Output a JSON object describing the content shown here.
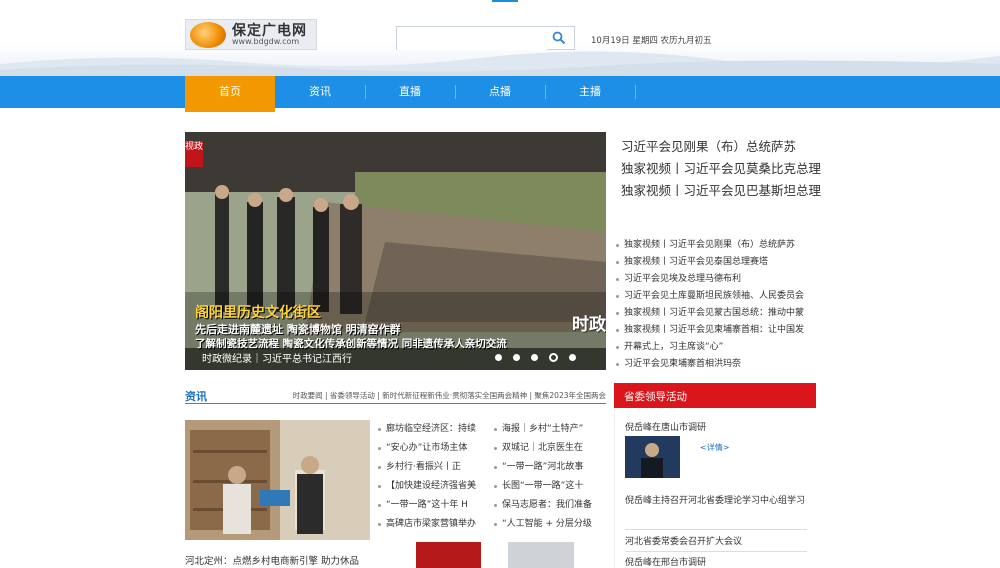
{
  "header": {
    "logo_cn": "保定广电网",
    "logo_en": "www.bdgdw.com",
    "search_placeholder": "",
    "date": "10月19日 星期四 农历九月初五"
  },
  "nav": {
    "items": [
      "首页",
      "资讯",
      "直播",
      "点播",
      "主播"
    ],
    "active": 0
  },
  "slider": {
    "badge_left": "视政",
    "overlay_title": "阁阳里历史文化街区",
    "overlay_line1": "先后走进南麓遗址 陶瓷博物馆 明清窑作群",
    "overlay_line2": "了解制瓷技艺流程 陶瓷文化传承创新等情况 同非遗传承人亲切交流",
    "badge_right": "时政",
    "caption": "时政微纪录｜习近平总书记江西行",
    "dots": 5,
    "active_dot": 3
  },
  "headlines": [
    "习近平会见刚果（布）总统萨苏",
    "独家视频丨习近平会见莫桑比克总理",
    "独家视频丨习近平会见巴基斯坦总理"
  ],
  "side_list": [
    "独家视频丨习近平会见刚果（布）总统萨苏",
    "独家视频丨习近平会见泰国总理赛塔",
    "习近平会见埃及总理马德布利",
    "习近平会见土库曼斯坦民族领袖、人民委员会",
    "独家视频丨习近平会见蒙古国总统：推动中蒙",
    "独家视频丨习近平会见柬埔寨首相：让中国发",
    "开幕式上，习主席谈“心”",
    "习近平会见柬埔寨首相洪玛奈"
  ],
  "news": {
    "title": "资讯",
    "links": "时政要闻 | 省委领导活动 | 新时代新征程新伟业·贯彻落实全国两会精神 | 聚焦2023年全国两会",
    "photo_caption": "河北定州：点燃乡村电商新引擎 助力休品",
    "col1": [
      "廊坊临空经济区：持续",
      "“安心办”让市场主体",
      "乡村行·看振兴丨正",
      "【加快建设经济强省美",
      "“一带一路”这十年 H",
      "高碑店市梁家营镇举办"
    ],
    "col2": [
      "海报｜乡村“土特产”",
      "双城记｜北京医生在",
      "“一带一路”河北故事",
      "长图“一带一路”这十",
      "保马志愿者：我们准备",
      "“人工智能 + 分层分级"
    ]
  },
  "province": {
    "title": "省委领导活动",
    "items": [
      "倪岳峰在唐山市调研",
      "倪岳峰主持召开河北省委理论学习中心组学习",
      "河北省委常委会召开扩大会议",
      "倪岳峰在邢台市调研"
    ],
    "detail": "<详情>"
  },
  "colors": {
    "nav_blue": "#1d8fe6",
    "active_orange": "#f39800",
    "province_red": "#d8161b"
  }
}
